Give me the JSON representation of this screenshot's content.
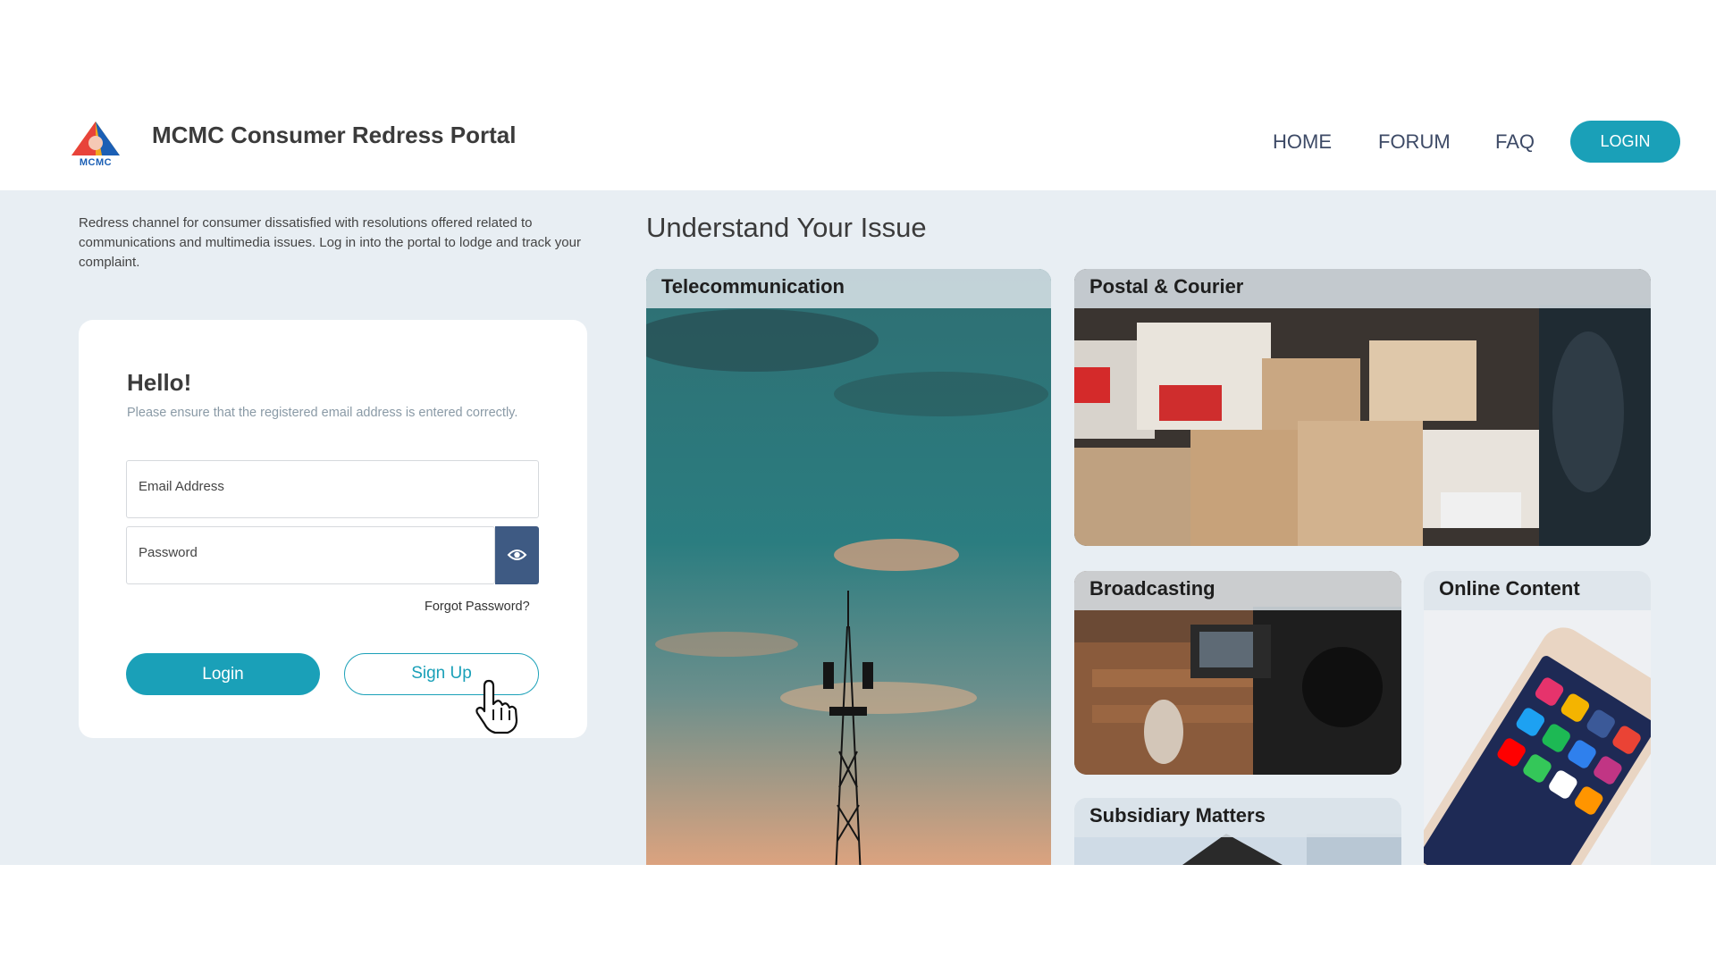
{
  "header": {
    "logo_text": "MCMC",
    "title": "MCMC Consumer Redress Portal",
    "nav": [
      "HOME",
      "FORUM",
      "FAQ"
    ],
    "login_label": "LOGIN"
  },
  "intro": "Redress channel for consumer dissatisfied with resolutions offered related to communications and multimedia issues. Log in into the portal to lodge and track your complaint.",
  "login_card": {
    "greeting": "Hello!",
    "note": "Please ensure that the registered email address is entered correctly.",
    "email_placeholder": "Email Address",
    "password_placeholder": "Password",
    "forgot": "Forgot Password?",
    "login_label": "Login",
    "signup_label": "Sign Up"
  },
  "issues": {
    "title": "Understand Your Issue",
    "tiles": [
      "Telecommunication",
      "Postal & Courier",
      "Broadcasting",
      "Online Content",
      "Subsidiary Matters"
    ]
  },
  "colors": {
    "accent": "#1aa0b8",
    "eye_button": "#3e5a83",
    "background": "#e8eef3"
  }
}
